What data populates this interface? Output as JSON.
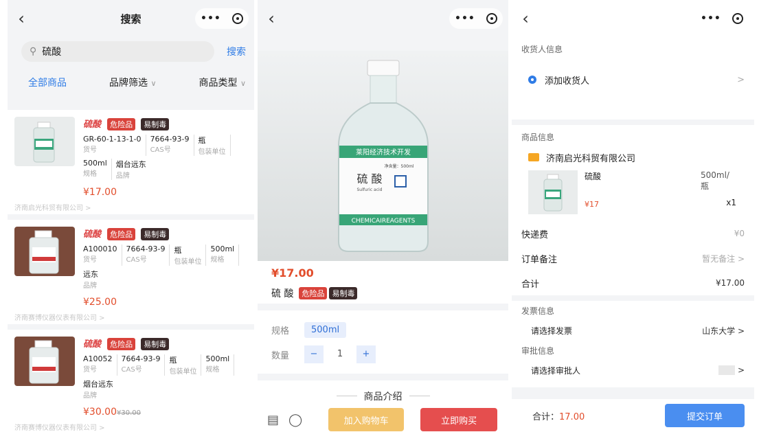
{
  "panel1": {
    "title": "搜索",
    "search": {
      "value": "硫酸",
      "button": "搜索"
    },
    "filters": [
      "全部商品",
      "品牌筛选",
      "商品类型"
    ],
    "labels": {
      "sku": "货号",
      "cas": "CAS号",
      "unit": "包装单位",
      "spec": "规格",
      "brand": "品牌"
    },
    "products": [
      {
        "name": "硫酸",
        "tags": [
          "危险品",
          "易制毒"
        ],
        "sku": "GR-60-1-13-1-0",
        "cas": "7664-93-9",
        "unit": "瓶",
        "spec": "500ml",
        "brand": "烟台远东",
        "price": "¥17.00",
        "old_price": "",
        "vendor": "济南启光科贸有限公司 >"
      },
      {
        "name": "硫酸",
        "tags": [
          "危险品",
          "易制毒"
        ],
        "sku": "A100010",
        "cas": "7664-93-9",
        "unit": "瓶",
        "spec": "500ml",
        "brand": "远东",
        "price": "¥25.00",
        "old_price": "",
        "vendor": "济南赛博仪器仪表有限公司 >"
      },
      {
        "name": "硫酸",
        "tags": [
          "危险品",
          "易制毒"
        ],
        "sku": "A10052",
        "cas": "7664-93-9",
        "unit": "瓶",
        "spec": "500ml",
        "brand": "烟台远东",
        "price": "¥30.00",
        "old_price": "¥30.00",
        "vendor": "济南赛博仪器仪表有限公司 >"
      }
    ]
  },
  "panel2": {
    "price": "¥17.00",
    "name": "硫 酸",
    "tags": [
      "危险品",
      "易制毒"
    ],
    "spec_label": "规格",
    "spec_value": "500ml",
    "qty_label": "数量",
    "qty": "1",
    "minus": "−",
    "plus": "+",
    "intro": "商品介绍",
    "add_cart": "加入购物车",
    "buy_now": "立即购买",
    "bottle_label": {
      "chinese": "硫 酸",
      "english": "Sulfuric acid",
      "brand": "CHEMICAIREAGENTS",
      "header": "莱阳经济技术开发",
      "net": "净含量：500ml"
    }
  },
  "panel3": {
    "receiver_title": "收货人信息",
    "add_receiver": "添加收货人",
    "product_title": "商品信息",
    "shop": "济南启光科贸有限公司",
    "item_name": "硫酸",
    "item_price": "¥17",
    "item_spec": "500ml/瓶",
    "item_qty": "x1",
    "shipping_label": "快递费",
    "shipping_value": "¥0",
    "remark_label": "订单备注",
    "remark_value": "暂无备注 >",
    "total_label": "合计",
    "total_value": "¥17.00",
    "invoice_title": "发票信息",
    "invoice_label": "请选择发票",
    "invoice_value": "山东大学 >",
    "approval_title": "审批信息",
    "approval_label": "请选择审批人",
    "approval_value": ">",
    "footer_total_label": "合计：",
    "footer_total_value": "17.00",
    "submit": "提交订单"
  },
  "colors": {
    "accent": "#2f7ce6",
    "price": "#e24d2b",
    "danger_tag": "#d9433b",
    "dark_tag": "#3b2a2a",
    "cart": "#f2c36b",
    "buy": "#e54e4e",
    "submit": "#4a8ef0"
  },
  "icons": {
    "back": "chevron-left-icon",
    "more": "more-dots-icon",
    "record": "target-icon",
    "search": "search-icon",
    "store": "store-icon",
    "cart": "cart-icon",
    "location": "location-pin-icon",
    "shop": "shop-icon"
  }
}
